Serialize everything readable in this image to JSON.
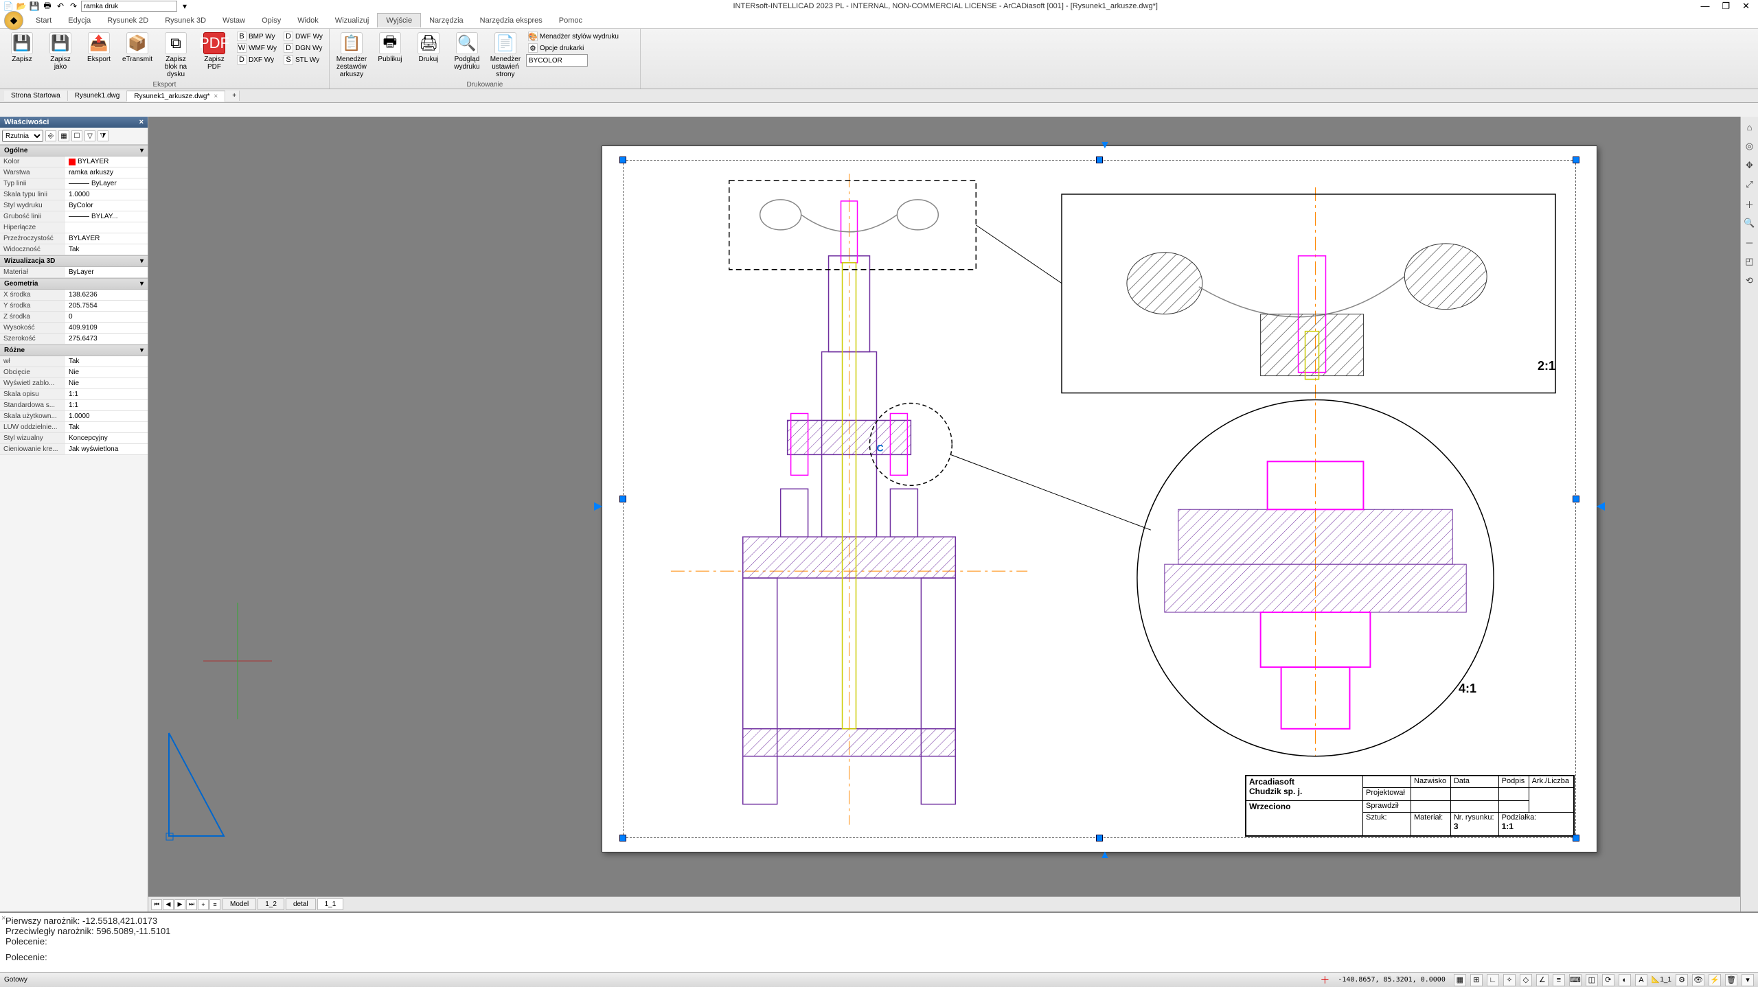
{
  "app": {
    "title": "INTERsoft-INTELLICAD 2023 PL - INTERNAL, NON-COMMERCIAL LICENSE - ArCADiasoft [001] - [Rysunek1_arkusze.dwg*]",
    "qat_layer": "ramka druk"
  },
  "ribbon": {
    "tabs": [
      "Start",
      "Edycja",
      "Rysunek 2D",
      "Rysunek 3D",
      "Wstaw",
      "Opisy",
      "Widok",
      "Wizualizuj",
      "Wyjście",
      "Narzędzia",
      "Narzędzia ekspres",
      "Pomoc"
    ],
    "active_tab": "Wyjście",
    "groups": {
      "eksport": {
        "label": "Eksport",
        "zapisz": "Zapisz",
        "zapisz_jako": "Zapisz jako",
        "eksport": "Eksport",
        "etransmit": "eTransmit",
        "zapisz_blok": "Zapisz blok na dysku",
        "zapisz_pdf": "Zapisz PDF",
        "bmp": "BMP Wy",
        "dwf": "DWF Wy",
        "wmf": "WMF Wy",
        "dgn": "DGN Wy",
        "dxf": "DXF Wy",
        "stl": "STL Wy"
      },
      "drukowanie": {
        "label": "Drukowanie",
        "menedzer_ark": "Menedżer zestawów arkuszy",
        "publikuj": "Publikuj",
        "drukuj": "Drukuj",
        "podglad": "Podgląd wydruku",
        "ustawienia": "Menedżer ustawień strony",
        "styl_mgr": "Menadżer stylów wydruku",
        "opcje": "Opcje drukarki",
        "color_sel": "BYCOLOR"
      }
    }
  },
  "doc_tabs": {
    "items": [
      "Strona Startowa",
      "Rysunek1.dwg",
      "Rysunek1_arkusze.dwg*"
    ],
    "active": 2
  },
  "props": {
    "title": "Właściwości",
    "selector": "Rzutnia",
    "sections": [
      {
        "name": "Ogólne",
        "rows": [
          {
            "k": "Kolor",
            "v": "BYLAYER",
            "color": true
          },
          {
            "k": "Warstwa",
            "v": "ramka arkuszy"
          },
          {
            "k": "Typ linii",
            "v": "ByLayer",
            "lt": true
          },
          {
            "k": "Skala typu linii",
            "v": "1.0000"
          },
          {
            "k": "Styl wydruku",
            "v": "ByColor"
          },
          {
            "k": "Grubość linii",
            "v": "BYLAY...",
            "lt": true
          },
          {
            "k": "Hiperłącze",
            "v": ""
          },
          {
            "k": "Przeźroczystość",
            "v": "BYLAYER"
          },
          {
            "k": "Widoczność",
            "v": "Tak"
          }
        ]
      },
      {
        "name": "Wizualizacja 3D",
        "rows": [
          {
            "k": "Materiał",
            "v": "ByLayer"
          }
        ]
      },
      {
        "name": "Geometria",
        "rows": [
          {
            "k": "X środka",
            "v": "138.6236"
          },
          {
            "k": "Y środka",
            "v": "205.7554"
          },
          {
            "k": "Z środka",
            "v": "0"
          },
          {
            "k": "Wysokość",
            "v": "409.9109"
          },
          {
            "k": "Szerokość",
            "v": "275.6473"
          }
        ]
      },
      {
        "name": "Różne",
        "rows": [
          {
            "k": "wł",
            "v": "Tak"
          },
          {
            "k": "Obcięcie",
            "v": "Nie"
          },
          {
            "k": "Wyświetl zablo...",
            "v": "Nie"
          },
          {
            "k": "Skala opisu",
            "v": "1:1"
          },
          {
            "k": "Standardowa s...",
            "v": "1:1"
          },
          {
            "k": "Skala użytkown...",
            "v": "1.0000"
          },
          {
            "k": "LUW oddzielnie...",
            "v": "Tak"
          },
          {
            "k": "Styl wizualny",
            "v": "Koncepcyjny"
          },
          {
            "k": "Cieniowanie kre...",
            "v": "Jak wyświetlona"
          }
        ]
      }
    ]
  },
  "drawing": {
    "detail1_scale": "2:1",
    "detail2_scale": "4:1",
    "section_label": "C"
  },
  "titleblock": {
    "company1": "Arcadiasoft",
    "company2": "Chudzik sp. j.",
    "part": "Wrzeciono",
    "hdr_nazwisko": "Nazwisko",
    "hdr_data": "Data",
    "hdr_podpis": "Podpis",
    "hdr_ark": "Ark./Liczba",
    "projektowal": "Projektował",
    "sprawdzil": "Sprawdził",
    "sztuk_lbl": "Sztuk:",
    "material_lbl": "Materiał:",
    "nrrys_lbl": "Nr. rysunku:",
    "podz_lbl": "Podziałka:",
    "nrrys": "3",
    "podz": "1:1"
  },
  "layout_tabs": {
    "items": [
      "Model",
      "1_2",
      "detal",
      "1_1"
    ],
    "active": 3
  },
  "cmdline": {
    "history": "Pierwszy narożnik: -12.5518,421.0173\nPrzeciwległy narożnik: 596.5089,-11.5101\nPolecenie:",
    "prompt": "Polecenie:"
  },
  "status": {
    "ready": "Gotowy",
    "coords": "-140.8657, 85.3201, 0.0000",
    "scale": "1_1"
  }
}
